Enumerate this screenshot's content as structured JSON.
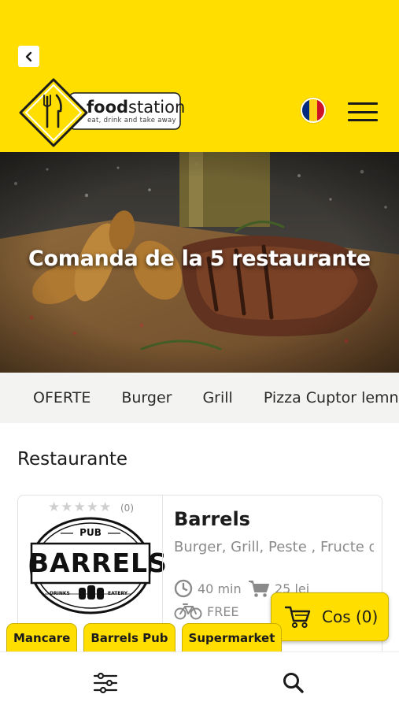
{
  "header": {
    "back_icon": "chevron-left-icon",
    "logo": {
      "name_part1": "food",
      "name_part2": "station",
      "tagline": "eat, drink and take away"
    },
    "language_flag": "romania-flag",
    "flag_colors": [
      "#002B7F",
      "#FCD116",
      "#CE1126"
    ],
    "menu_icon": "hamburger-menu-icon"
  },
  "hero": {
    "title": "Comanda de la 5 restaurante"
  },
  "categories": [
    {
      "label": "OFERTE"
    },
    {
      "label": "Burger"
    },
    {
      "label": "Grill"
    },
    {
      "label": "Pizza Cuptor lemne"
    }
  ],
  "section": {
    "title": "Restaurante"
  },
  "restaurant": {
    "rating_stars": 0,
    "rating_count": "(0)",
    "logo_text": {
      "top": "PUB",
      "main": "BARRELS",
      "left": "DRINKS",
      "right": "EATERY"
    },
    "name": "Barrels",
    "categories": "Burger, Grill, Peste , Fructe d...",
    "delivery_time": "40 min",
    "min_order": "25 lei",
    "delivery_fee": "FREE"
  },
  "cart": {
    "label": "Cos (0)",
    "icon": "shopping-cart-icon"
  },
  "tags": [
    {
      "label": "Mancare"
    },
    {
      "label": "Barrels Pub"
    },
    {
      "label": "Supermarket"
    }
  ],
  "bottom_nav": {
    "filter_icon": "sliders-filter-icon",
    "search_icon": "search-icon"
  },
  "colors": {
    "brand_yellow": "#FFDE00",
    "text_dark": "#1B1B1B",
    "text_muted": "#8A8A8A"
  }
}
